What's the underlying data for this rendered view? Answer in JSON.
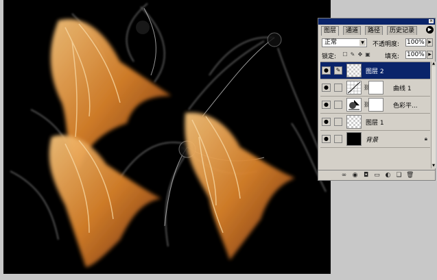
{
  "palette": {
    "tabs": [
      {
        "label": "图层"
      },
      {
        "label": "通道"
      },
      {
        "label": "路径"
      },
      {
        "label": "历史记录"
      }
    ],
    "menu_icon": "triangle-right-icon",
    "blend_mode": "正常",
    "opacity_label": "不透明度:",
    "opacity_value": "100%",
    "lock_label": "锁定:",
    "fill_label": "填充:",
    "fill_value": "100%",
    "layers": [
      {
        "name": "图层 2",
        "thumb": "transparent",
        "selected": true,
        "visible": true
      },
      {
        "name": "曲线 1",
        "thumb": "curves-adjustment",
        "has_mask": true,
        "visible": true
      },
      {
        "name": "色彩平...",
        "thumb": "color-balance-adjustment",
        "has_mask": true,
        "visible": true
      },
      {
        "name": "图层 1",
        "thumb": "transparent",
        "visible": true
      },
      {
        "name": "背景",
        "thumb": "black",
        "locked": true,
        "visible": true
      }
    ],
    "footer_icons": [
      "link-layers-icon",
      "layer-style-icon",
      "layer-mask-icon",
      "new-set-icon",
      "adjustment-layer-icon",
      "new-layer-icon",
      "trash-icon"
    ]
  }
}
